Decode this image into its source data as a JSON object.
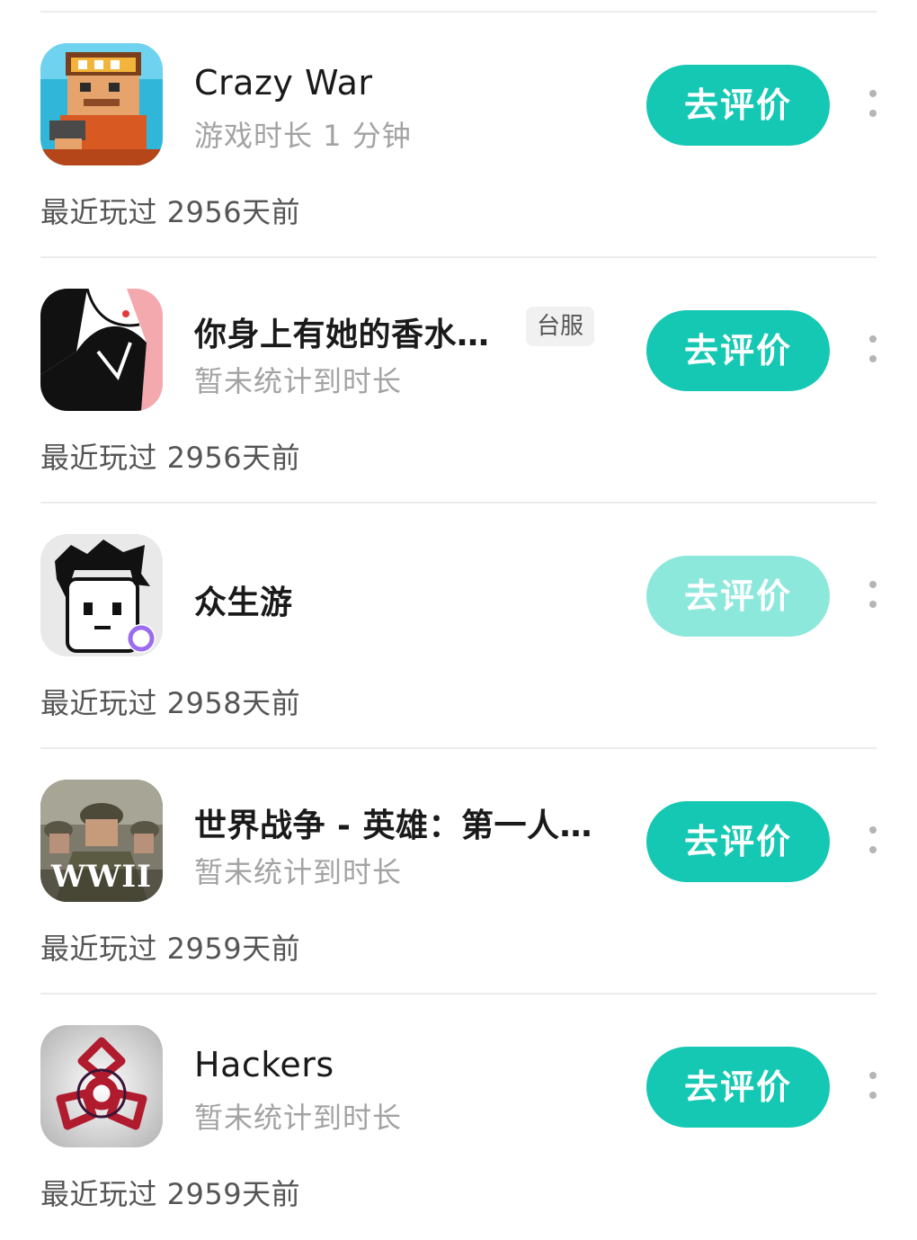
{
  "items": [
    {
      "title": "Crazy War",
      "subtitle": "游戏时长 1 分钟",
      "tag": "",
      "button": "去评价",
      "recent": "最近玩过 2956天前",
      "icon": "crazy-war-icon"
    },
    {
      "title": "你身上有她的香水…",
      "subtitle": "暂未统计到时长",
      "tag": "台服",
      "button": "去评价",
      "recent": "最近玩过 2956天前",
      "icon": "perfume-game-icon"
    },
    {
      "title": "众生游",
      "subtitle": "",
      "tag": "",
      "button": "去评价",
      "recent": "最近玩过 2958天前",
      "icon": "zhongshengyou-icon"
    },
    {
      "title": "世界战争 - 英雄：第一人…",
      "subtitle": "暂未统计到时长",
      "tag": "",
      "button": "去评价",
      "recent": "最近玩过 2959天前",
      "icon": "wwii-icon",
      "icon_text": "WWII"
    },
    {
      "title": "Hackers",
      "subtitle": "暂未统计到时长",
      "tag": "",
      "button": "去评价",
      "recent": "最近玩过 2959天前",
      "icon": "hackers-icon"
    }
  ],
  "colors": {
    "accent": "#15c8b3",
    "accent_disabled": "#8de8dc",
    "subtext": "#a3a3a3",
    "divider": "#ececec"
  }
}
